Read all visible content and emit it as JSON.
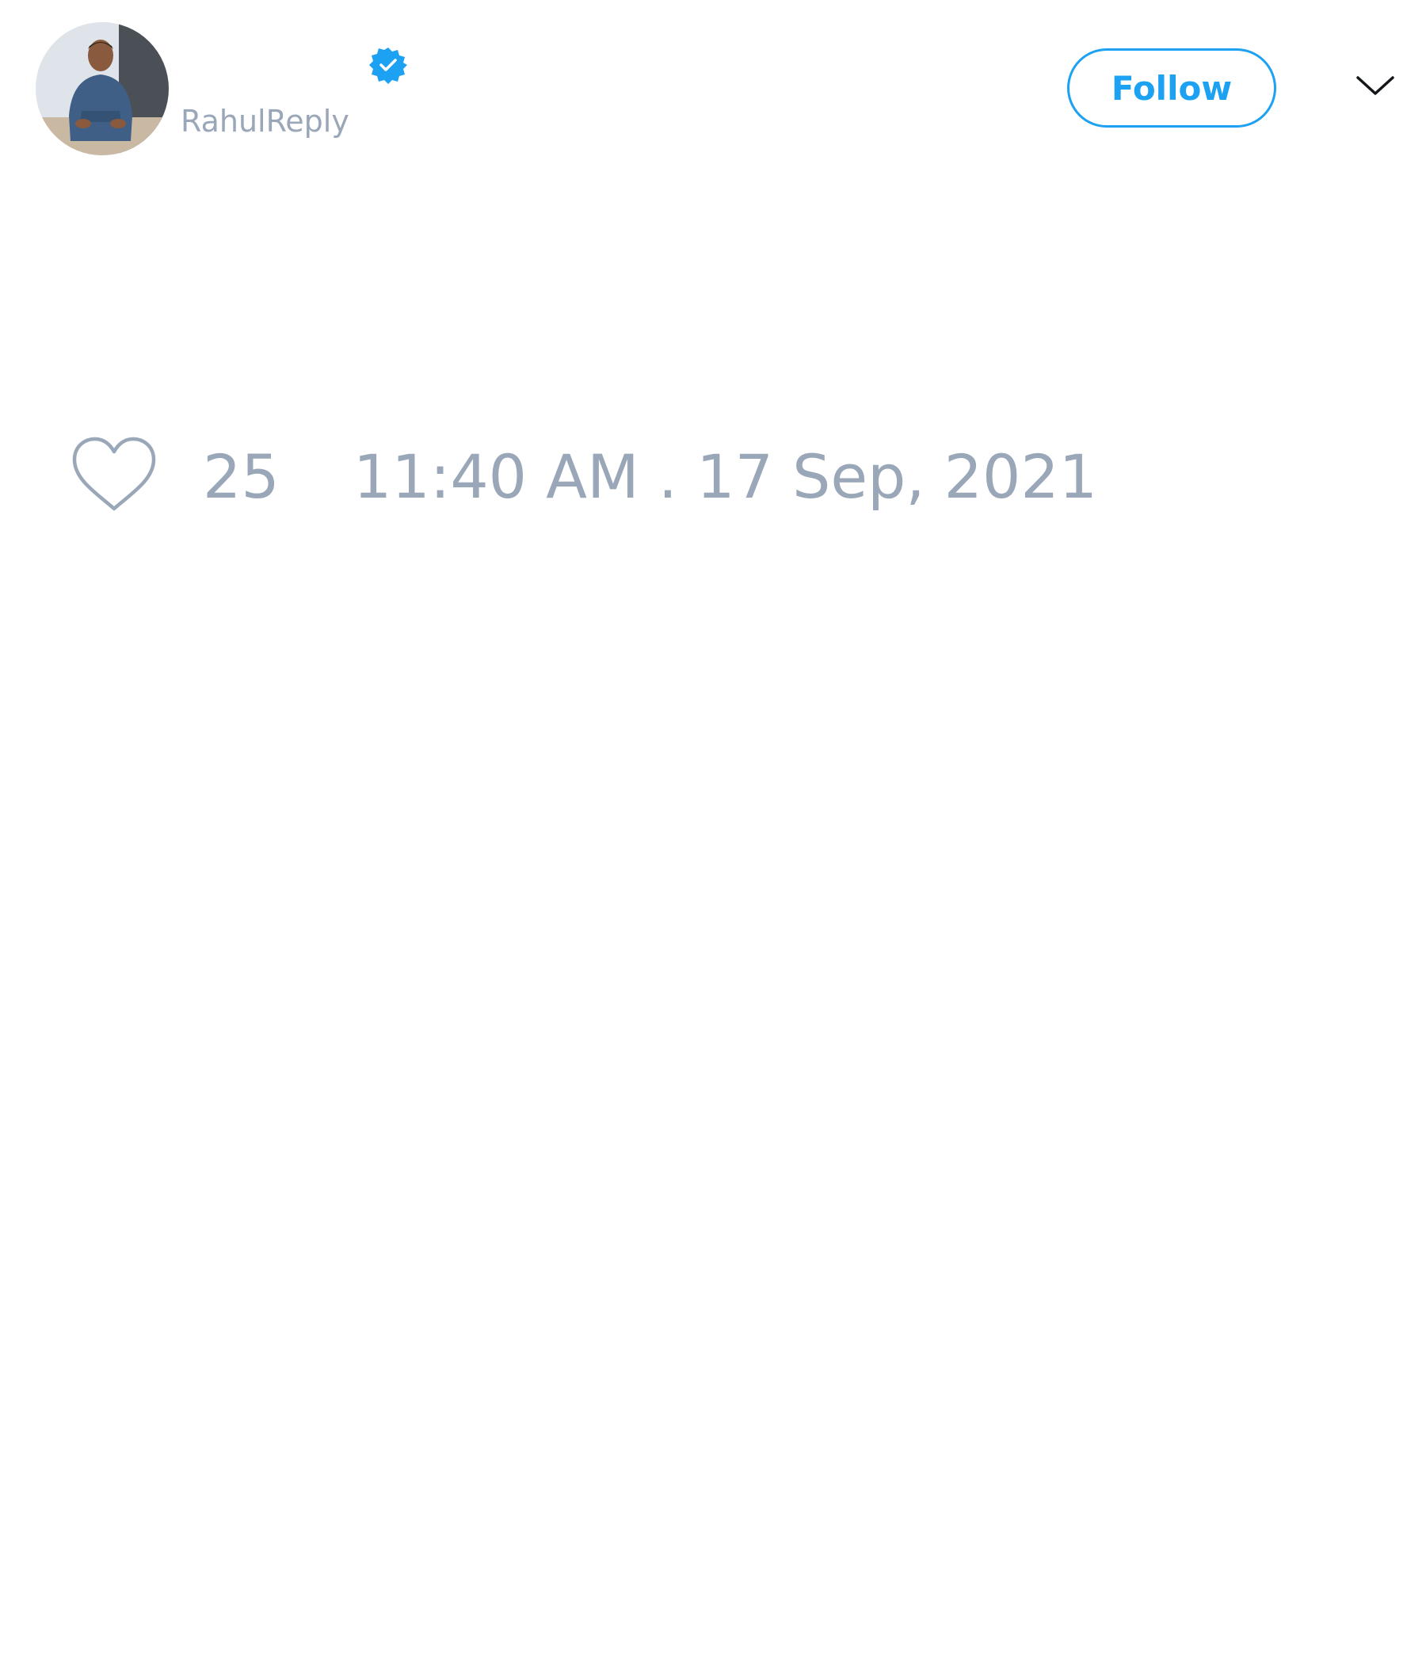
{
  "tweet": {
    "author": {
      "display_name": "",
      "handle": "RahulReply",
      "verified": true,
      "avatar_icon": "avatar-photo"
    },
    "follow_label": "Follow",
    "menu_icon": "chevron-down-icon",
    "like_icon": "heart-outline-icon",
    "like_count": "25",
    "timestamp": "11:40 AM . 17 Sep, 2021"
  },
  "colors": {
    "accent": "#1da1f2",
    "muted_text": "#9aa7b8",
    "background": "#ffffff"
  }
}
